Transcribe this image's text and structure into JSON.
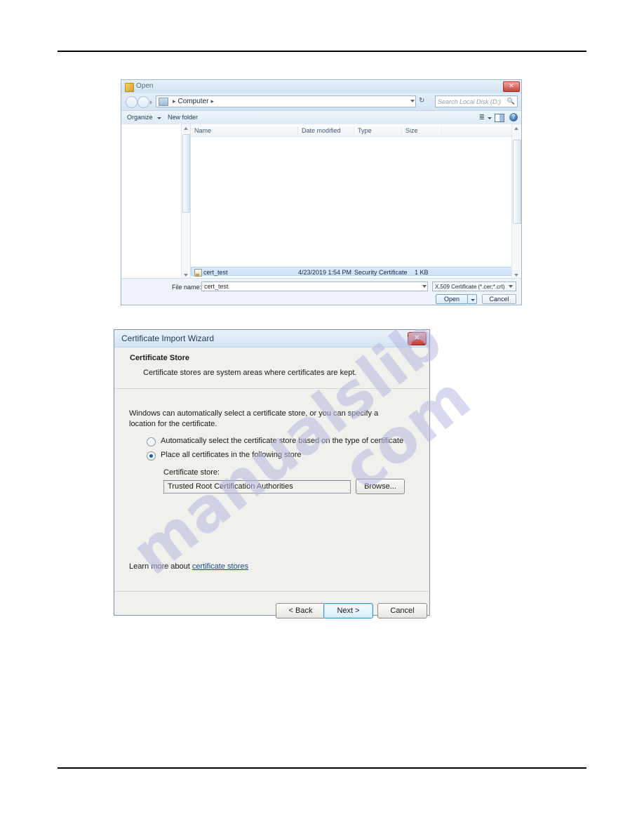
{
  "open_dialog": {
    "title": "Open",
    "title_icon": "folder-icon",
    "breadcrumb": {
      "root": "Computer",
      "separator": "▸"
    },
    "search": {
      "placeholder": "Search Local Disk (D:)",
      "icon": "search-icon"
    },
    "refresh_icon": "↻",
    "commandbar": {
      "organize": "Organize",
      "new_folder": "New folder",
      "view_icon": "list-view-icon",
      "preview_icon": "preview-pane-icon",
      "help_icon": "?"
    },
    "columns": [
      {
        "key": "name",
        "label": "Name"
      },
      {
        "key": "date",
        "label": "Date modified"
      },
      {
        "key": "type",
        "label": "Type"
      },
      {
        "key": "size",
        "label": "Size"
      }
    ],
    "files": [
      {
        "name": "cert_test",
        "date_modified": "4/23/2019 1:54 PM",
        "type": "Security Certificate",
        "size": "1 KB",
        "selected": true,
        "icon": "certificate-file-icon"
      }
    ],
    "footer": {
      "filename_label": "File name:",
      "filename_value": "cert_test",
      "filetype_value": "X.509 Certificate (*.cer;*.crt)",
      "open_label": "Open",
      "cancel_label": "Cancel"
    }
  },
  "wizard": {
    "title": "Certificate Import Wizard",
    "close_label": "✕",
    "heading": "Certificate Store",
    "subheading": "Certificate stores are system areas where certificates are kept.",
    "intro": "Windows can automatically select a certificate store, or you can specify a location for the certificate.",
    "options": [
      {
        "id": "auto",
        "label": "Automatically select the certificate store based on the type of certificate",
        "selected": false
      },
      {
        "id": "place",
        "label": "Place all certificates in the following store",
        "selected": true
      }
    ],
    "cert_store_label": "Certificate store:",
    "cert_store_value": "Trusted Root Certification Authorities",
    "browse_label": "Browse...",
    "learn_more_prefix": "Learn more about ",
    "learn_more_link": "certificate stores",
    "buttons": {
      "back": "< Back",
      "next": "Next >",
      "cancel": "Cancel"
    }
  },
  "watermark": {
    "word_left": "manualslib",
    "word_right": "com"
  },
  "colors": {
    "accent": "#3c94d4",
    "link": "#17488f",
    "close_red": "#c1392f",
    "selection_blue": "#cfe2f7",
    "watermark": "#b9b9e2"
  }
}
